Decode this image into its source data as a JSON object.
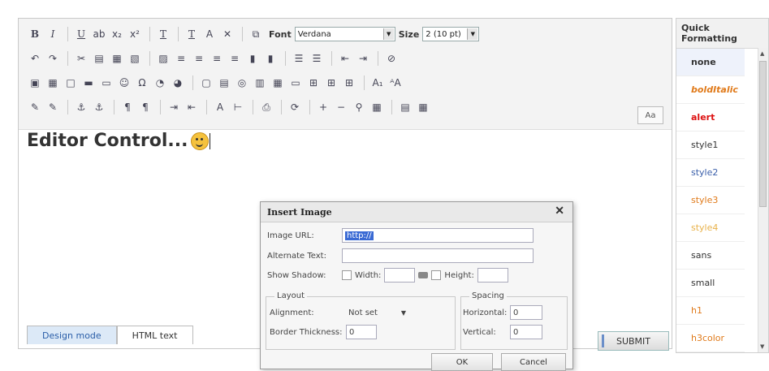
{
  "toolbar": {
    "row1_buttons": [
      "B",
      "I",
      "U",
      "ab",
      "x₂",
      "x²",
      "T",
      "T",
      "A",
      "✕",
      "⧉"
    ],
    "font_label": "Font",
    "font_value": "Verdana",
    "size_label": "Size",
    "size_value": "2 (10 pt)",
    "row2_buttons": [
      "↶",
      "↷",
      "✂",
      "▤",
      "▦",
      "▧",
      "▨",
      "≡",
      "≡",
      "≡",
      "≡",
      "▮",
      "▮",
      "☰",
      "☰",
      "⇤",
      "⇥",
      "⊘"
    ],
    "row3_buttons": [
      "▣",
      "▦",
      "□",
      "▬",
      "▭",
      "☺",
      "Ω",
      "◔",
      "◕",
      "▢",
      "▤",
      "◎",
      "▥",
      "▦",
      "▭",
      "⊞",
      "⊞",
      "⊞",
      "A₁",
      "ᴬA"
    ],
    "row4_buttons": [
      "✎",
      "✎",
      "⚓",
      "⚓",
      "¶",
      "¶",
      "⇥",
      "⇤",
      "A",
      "⊢",
      "⎙",
      "⟳",
      "+",
      "−",
      "⚲",
      "▦",
      "▤",
      "▦"
    ],
    "aa_label": "Aa"
  },
  "content": {
    "text": "Editor Control..."
  },
  "tabs": {
    "design": "Design mode",
    "html": "HTML text"
  },
  "submit_label": "SUBMIT",
  "quick_formatting": {
    "title": "Quick Formatting",
    "items": [
      {
        "label": "none",
        "color": "#333333",
        "bold": true
      },
      {
        "label": "boldItalic",
        "color": "#e07a1a",
        "bold": true
      },
      {
        "label": "alert",
        "color": "#dd1111",
        "bold": true
      },
      {
        "label": "style1",
        "color": "#333333",
        "bold": false
      },
      {
        "label": "style2",
        "color": "#3a5faa",
        "bold": false
      },
      {
        "label": "style3",
        "color": "#e07a1a",
        "bold": false
      },
      {
        "label": "style4",
        "color": "#e8b24a",
        "bold": false
      },
      {
        "label": "sans",
        "color": "#333333",
        "bold": false
      },
      {
        "label": "small",
        "color": "#333333",
        "bold": false
      },
      {
        "label": "h1",
        "color": "#e07a1a",
        "bold": false
      },
      {
        "label": "h3color",
        "color": "#e07a1a",
        "bold": false
      }
    ]
  },
  "dialog": {
    "title": "Insert Image",
    "close": "✕",
    "image_url_label": "Image URL:",
    "image_url_value": "http://",
    "alt_text_label": "Alternate Text:",
    "alt_text_value": "",
    "shadow_label": "Show Shadow:",
    "width_label": "Width:",
    "height_label": "Height:",
    "layout_legend": "Layout",
    "alignment_label": "Alignment:",
    "alignment_value": "Not set",
    "border_label": "Border Thickness:",
    "border_value": "0",
    "spacing_legend": "Spacing",
    "horizontal_label": "Horizontal:",
    "horizontal_value": "0",
    "vertical_label": "Vertical:",
    "vertical_value": "0",
    "ok_label": "OK",
    "cancel_label": "Cancel"
  }
}
